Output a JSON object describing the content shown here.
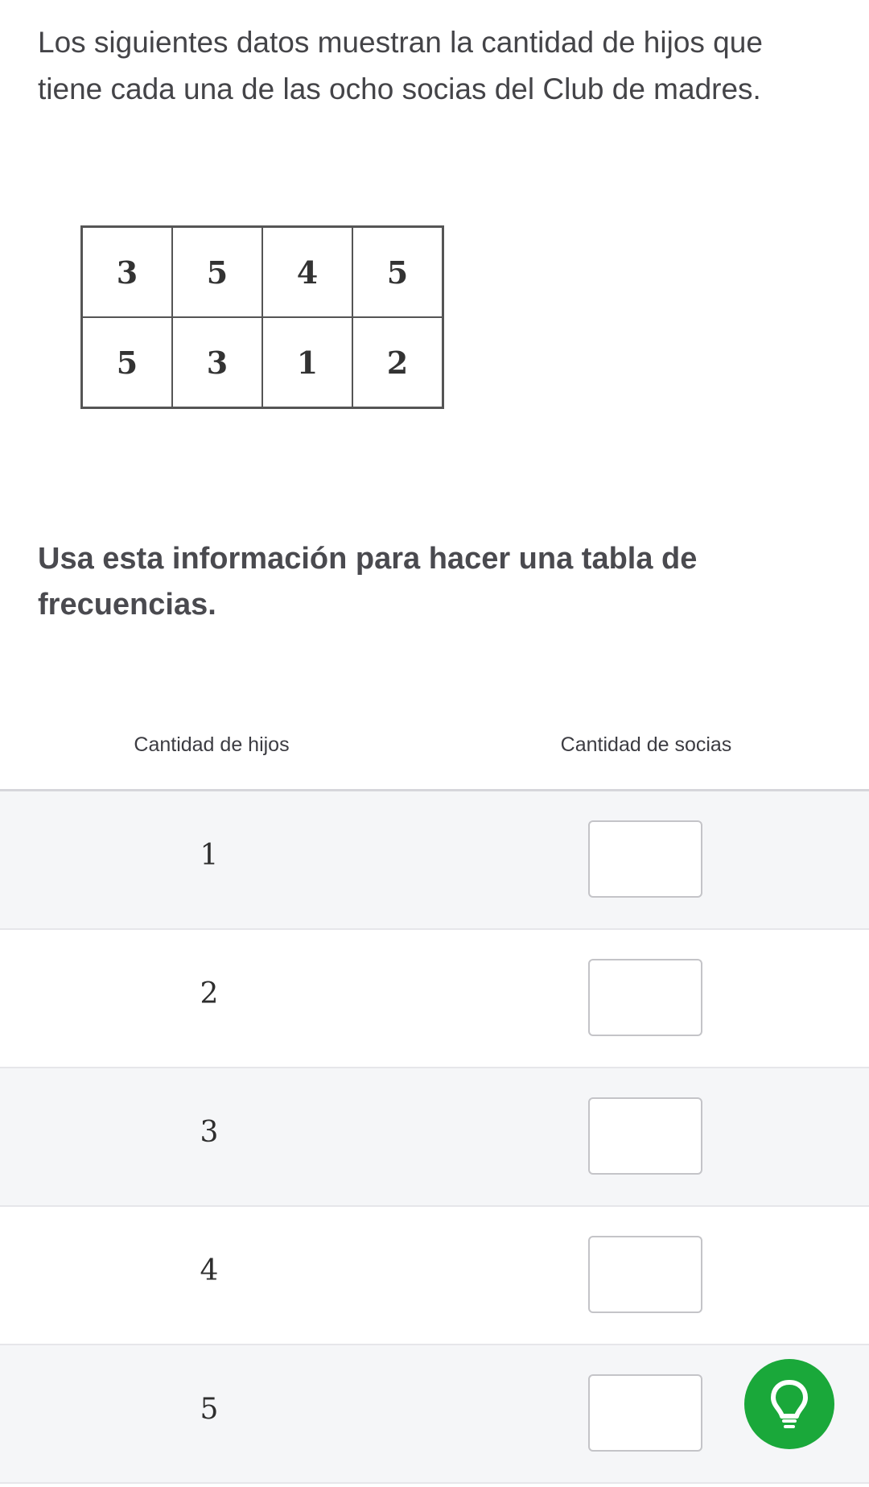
{
  "question": {
    "intro": "Los siguientes datos muestran la cantidad de hijos que tiene cada una de las ocho socias del Club de madres.",
    "data_rows": [
      [
        "3",
        "5",
        "4",
        "5"
      ],
      [
        "5",
        "3",
        "1",
        "2"
      ]
    ],
    "instruction": "Usa esta información para hacer una tabla de frecuencias."
  },
  "frequency_table": {
    "header_left": "Cantidad de hijos",
    "header_right": "Cantidad de socias",
    "rows": [
      {
        "value": "1",
        "answer": ""
      },
      {
        "value": "2",
        "answer": ""
      },
      {
        "value": "3",
        "answer": ""
      },
      {
        "value": "4",
        "answer": ""
      },
      {
        "value": "5",
        "answer": ""
      }
    ]
  },
  "hint": {
    "icon": "lightbulb-icon",
    "color": "#1aa83a"
  }
}
